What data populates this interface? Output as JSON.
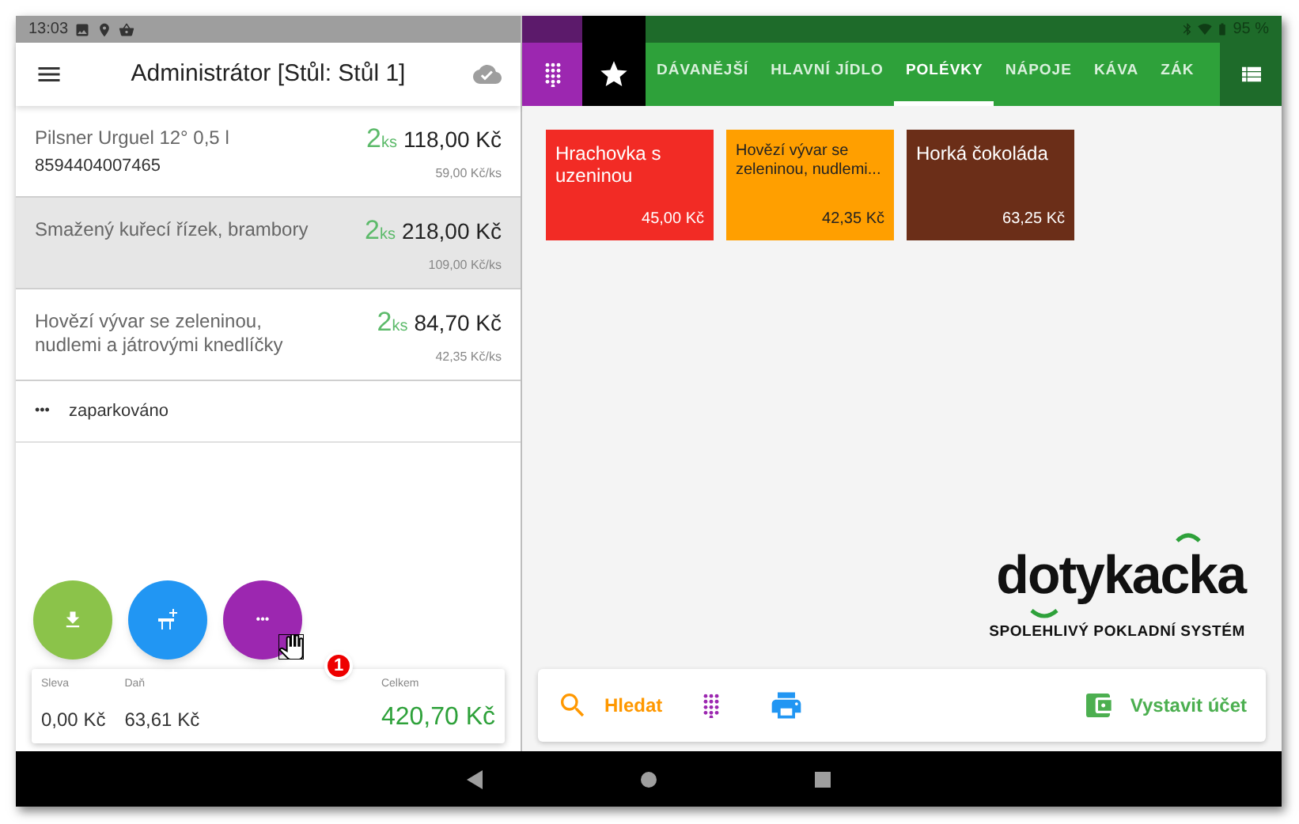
{
  "status_bar": {
    "time": "13:03",
    "battery": "95 %"
  },
  "left_toolbar": {
    "title": "Administrátor [Stůl: Stůl 1]"
  },
  "order_items": [
    {
      "name": "Pilsner Urguel 12° 0,5 l",
      "code": "8594404007465",
      "qty": "2",
      "unit": "ks",
      "total": "118,00 Kč",
      "unit_price": "59,00 Kč/ks",
      "selected": false
    },
    {
      "name": "Smažený kuřecí řízek, brambory",
      "qty": "2",
      "unit": "ks",
      "total": "218,00 Kč",
      "unit_price": "109,00 Kč/ks",
      "selected": true
    },
    {
      "name": "Hovězí vývar se zeleninou, nudlemi a játrovými knedlíčky",
      "qty": "2",
      "unit": "ks",
      "total": "84,70 Kč",
      "unit_price": "42,35 Kč/ks",
      "selected": false
    }
  ],
  "parked": {
    "icon": "•••",
    "label": "zaparkováno"
  },
  "fab_more": {
    "label": "•••"
  },
  "step_badge": "1",
  "summary": [
    {
      "label": "Sleva",
      "value": "0,00 Kč",
      "kind": "plain"
    },
    {
      "label": "Daň",
      "value": "63,61 Kč",
      "kind": "plain"
    },
    {
      "label": "Celkem",
      "value": "420,70 Kč",
      "kind": "total"
    }
  ],
  "category_tabs": [
    {
      "label": "DÁVANĚJŠÍ",
      "selected": false
    },
    {
      "label": "HLAVNÍ JÍDLO",
      "selected": false
    },
    {
      "label": "POLÉVKY",
      "selected": true
    },
    {
      "label": "NÁPOJE",
      "selected": false
    },
    {
      "label": "KÁVA",
      "selected": false
    },
    {
      "label": "ZÁK",
      "selected": false
    }
  ],
  "products": [
    {
      "name": "Hrachovka s uzeninou",
      "price": "45,00 Kč",
      "color": "#f22b25",
      "dark_text": false
    },
    {
      "name": "Hovězí vývar se zeleninou, nudlemi...",
      "price": "42,35 Kč",
      "color": "#ff9f00",
      "dark_text": true
    },
    {
      "name": "Horká čokoláda",
      "price": "63,25 Kč",
      "color": "#6b2e18",
      "dark_text": false
    }
  ],
  "logo": {
    "name": "dotykacka",
    "tagline": "SPOLEHLIVÝ POKLADNÍ SYSTÉM"
  },
  "bottom_bar": {
    "search": "Hledat",
    "checkout": "Vystavit účet"
  }
}
